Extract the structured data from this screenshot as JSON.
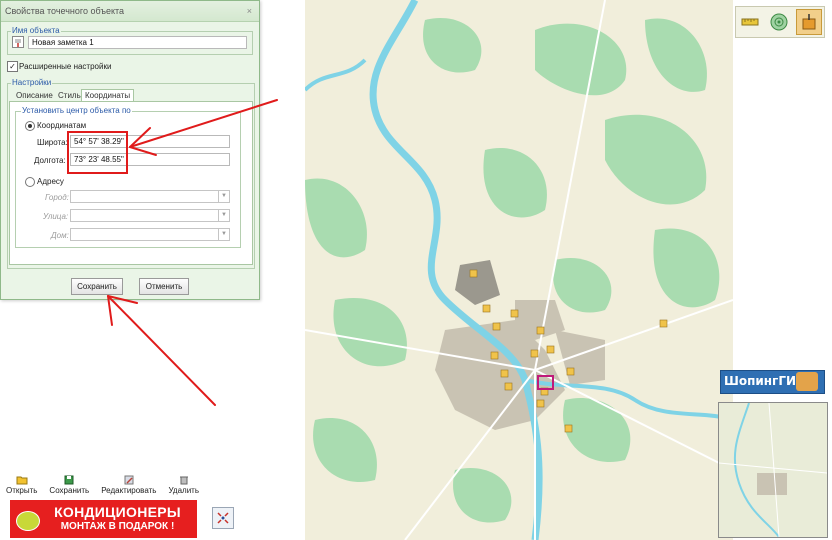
{
  "dialog": {
    "title": "Свойства точечного объекта",
    "close_glyph": "×",
    "name_legend": "Имя объекта",
    "name_value": "Новая заметка 1",
    "extended_settings_label": "Расширенные настройки",
    "extended_settings_checked": true,
    "settings_legend": "Настройки",
    "tabs": [
      {
        "label": "Описание",
        "active": false
      },
      {
        "label": "Стиль",
        "active": false
      },
      {
        "label": "Координаты",
        "active": true
      }
    ],
    "center_legend": "Установить центр объекта по",
    "coords_radio_label": "Координатам",
    "coords_radio_selected": true,
    "latitude_label": "Широта:",
    "latitude_value": "54° 57' 38.29\"",
    "longitude_label": "Долгота:",
    "longitude_value": "73° 23' 48.55\"",
    "address_radio_label": "Адресу",
    "address_radio_selected": false,
    "city_label": "Город:",
    "street_label": "Улица:",
    "house_label": "Дом:",
    "save_label": "Сохранить",
    "cancel_label": "Отменить"
  },
  "left_toolbar": {
    "items": [
      {
        "label": "Открыть",
        "icon": "folder-open-icon"
      },
      {
        "label": "Сохранить",
        "icon": "save-icon"
      },
      {
        "label": "Редактировать",
        "icon": "edit-icon"
      },
      {
        "label": "Удалить",
        "icon": "trash-icon"
      }
    ]
  },
  "ad": {
    "line1": "КОНДИЦИОНЕРЫ",
    "line2": "МОНТАЖ В ПОДАРОК !"
  },
  "map": {
    "place_labels": [],
    "tools": [
      {
        "icon": "ruler-icon"
      },
      {
        "icon": "radar-icon"
      },
      {
        "icon": "marker-tool-icon",
        "active": true
      }
    ],
    "shop_badge": "ШопингГИС",
    "colors": {
      "land": "#f1eedb",
      "forest": "#a9dcb0",
      "water": "#7fd3e6",
      "urban": "#c9c3b3",
      "marker": "#f0c34a",
      "annotation": "#e01b1b"
    }
  }
}
